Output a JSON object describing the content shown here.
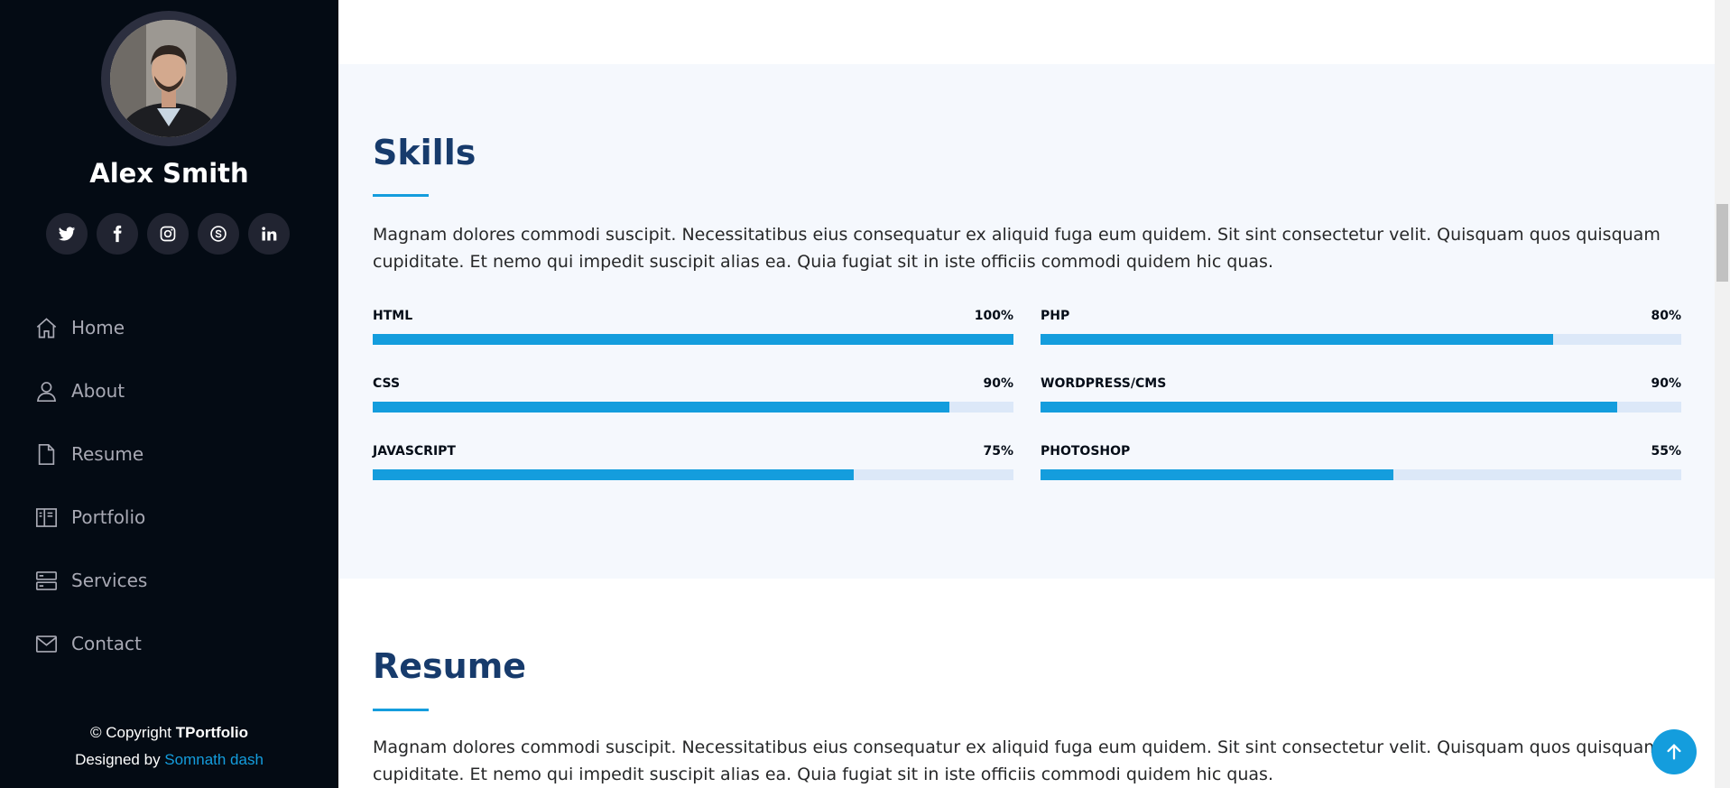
{
  "profile": {
    "name": "Alex Smith"
  },
  "socials": [
    {
      "icon": "twitter-icon"
    },
    {
      "icon": "facebook-icon"
    },
    {
      "icon": "instagram-icon"
    },
    {
      "icon": "skype-icon"
    },
    {
      "icon": "linkedin-icon"
    }
  ],
  "nav": {
    "items": [
      {
        "label": "Home",
        "icon": "home-icon"
      },
      {
        "label": "About",
        "icon": "person-icon"
      },
      {
        "label": "Resume",
        "icon": "file-icon"
      },
      {
        "label": "Portfolio",
        "icon": "book-icon"
      },
      {
        "label": "Services",
        "icon": "server-icon"
      },
      {
        "label": "Contact",
        "icon": "envelope-icon"
      }
    ]
  },
  "footer": {
    "copyright_prefix": "© Copyright ",
    "brand": "TPortfolio",
    "designed_prefix": "Designed by ",
    "designer": "Somnath dash"
  },
  "skills": {
    "title": "Skills",
    "description": "Magnam dolores commodi suscipit. Necessitatibus eius consequatur ex aliquid fuga eum quidem. Sit sint consectetur velit. Quisquam quos quisquam cupiditate. Et nemo qui impedit suscipit alias ea. Quia fugiat sit in iste officiis commodi quidem hic quas.",
    "items": [
      {
        "name": "HTML",
        "value": "100%",
        "level": 100
      },
      {
        "name": "PHP",
        "value": "80%",
        "level": 80
      },
      {
        "name": "CSS",
        "value": "90%",
        "level": 90
      },
      {
        "name": "WORDPRESS/CMS",
        "value": "90%",
        "level": 90
      },
      {
        "name": "JAVASCRIPT",
        "value": "75%",
        "level": 75
      },
      {
        "name": "PHOTOSHOP",
        "value": "55%",
        "level": 55
      }
    ]
  },
  "resume": {
    "title": "Resume",
    "description": "Magnam dolores commodi suscipit. Necessitatibus eius consequatur ex aliquid fuga eum quidem. Sit sint consectetur velit. Quisquam quos quisquam cupiditate. Et nemo qui impedit suscipit alias ea. Quia fugiat sit in iste officiis commodi quidem hic quas."
  },
  "colors": {
    "accent": "#149ddd",
    "sidebar_bg": "#040b14",
    "heading": "#173b6c",
    "track": "#dce8f8",
    "section_bg": "#f5f8fd"
  },
  "back_to_top": {
    "icon": "arrow-up-icon"
  }
}
